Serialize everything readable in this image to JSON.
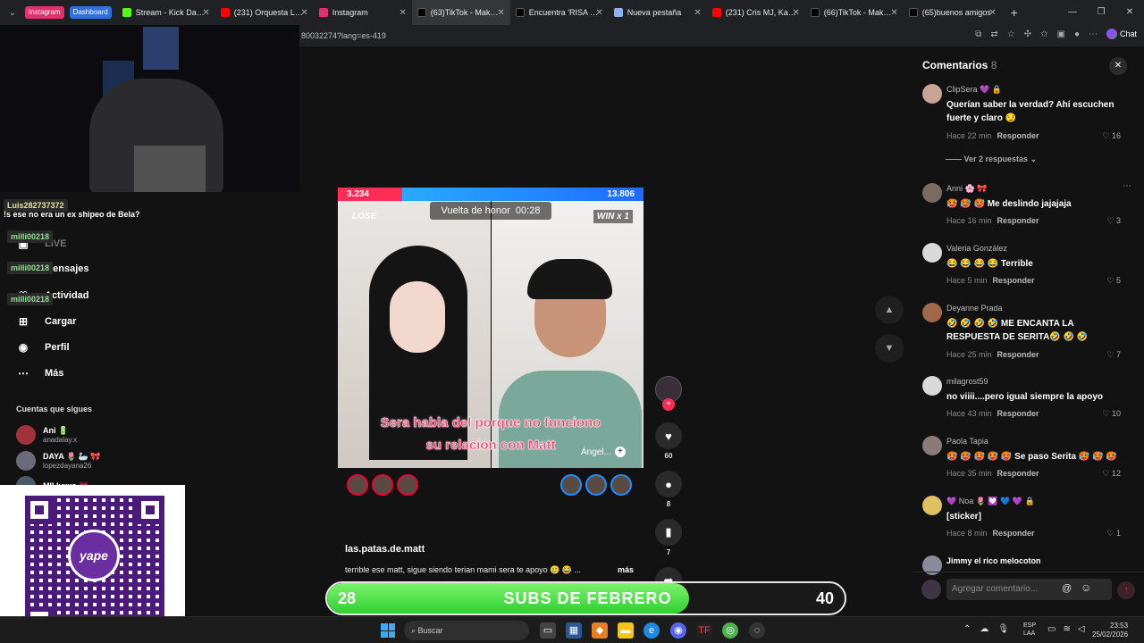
{
  "browser": {
    "pills": [
      {
        "label": "Instagram",
        "color": "#e1306c"
      },
      {
        "label": "Dashboard",
        "color": "#2f6fde"
      }
    ],
    "tabs": [
      {
        "label": "Stream - Kick Dashb",
        "color": "#53fc18"
      },
      {
        "label": "(231) Orquesta La Be",
        "color": "#ff0000"
      },
      {
        "label": "Instagram",
        "color": "#e1306c"
      },
      {
        "label": "(63)TikTok - Make Yo",
        "color": "#000000"
      },
      {
        "label": "Encuentra 'RISA DE 2",
        "color": "#000000"
      },
      {
        "label": "Nueva pestaña",
        "color": "#8ab4f8"
      },
      {
        "label": "(231) Cris MJ, Kali Uc",
        "color": "#ff0000"
      },
      {
        "label": "(66)TikTok - Make Yo",
        "color": "#000000"
      },
      {
        "label": "(65)buenos amigos",
        "color": "#000000"
      }
    ],
    "active_tab": 3,
    "url": "80032274?lang=es-419",
    "chat_label": "Chat"
  },
  "stream_chat": {
    "items": [
      {
        "user": "Luis282737372",
        "message": "!s ese no era un ex shipeo de Bela?"
      },
      {
        "user": "milli00218",
        "message": ""
      },
      {
        "user": "milli00218",
        "message": ""
      },
      {
        "user": "milli00218",
        "message": ""
      }
    ]
  },
  "sidebar": {
    "items": [
      {
        "label": "LIVE",
        "icon": "live-icon"
      },
      {
        "label": "Mensajes",
        "icon": "message-icon"
      },
      {
        "label": "Actividad",
        "icon": "activity-icon"
      },
      {
        "label": "Cargar",
        "icon": "upload-icon"
      },
      {
        "label": "Perfil",
        "icon": "profile-icon"
      },
      {
        "label": "Más",
        "icon": "more-icon"
      }
    ],
    "following_title": "Cuentas que sigues",
    "following": [
      {
        "name": "Ani 🔋",
        "handle": "anadalay.x",
        "color": "#a2323a"
      },
      {
        "name": "DAYA 🌷 🦢 🎀",
        "handle": "lopezdayana26",
        "color": "#6a6a7a"
      },
      {
        "name": "MII lyxxs 💗",
        "handle": "",
        "color": "#4a5a6a"
      }
    ]
  },
  "qr": {
    "brand": "yape"
  },
  "video": {
    "score_left": "3.234",
    "score_right": "13.806",
    "lose_label": "LOSE",
    "honor_label": "Vuelta de honor",
    "honor_time": "00:28",
    "win_label": "WIN x 1",
    "caption_line1": "Sera habla del porque no funciono",
    "caption_line2": "su relacion con Matt",
    "host_label": "Ángel...",
    "username": "las.patas.de.matt",
    "description": "terrible ese matt, sigue siendo terian mami sera te apoyo 🥲 😂 ...",
    "more_label": "más"
  },
  "actions": {
    "likes": "60",
    "comments": "8",
    "saves": "7"
  },
  "subs_goal": {
    "current": "28",
    "goal": "40",
    "title": "SUBS DE FEBRERO",
    "progress": 0.7
  },
  "comments_panel": {
    "title": "Comentarios",
    "count": "8",
    "view_replies": "Ver 2 respuestas",
    "reply_label": "Responder",
    "input_placeholder": "Agregar comentario...",
    "items": [
      {
        "user": "ClipSera 💜 🔒",
        "text": "Querían saber la verdad? Ahí escuchen fuerte y claro 😏",
        "time": "Hace 22 min",
        "likes": "16",
        "color": "#c7a496"
      },
      {
        "user": "Anni 🌸 🎀",
        "text": "🥵 🥵 🥵 Me deslindo jajajaja",
        "time": "Hace 16 min",
        "likes": "3",
        "color": "#7a6a60"
      },
      {
        "user": "Valeria González",
        "text": "😂 😂 😂 😂 Terrible",
        "time": "Hace 5 min",
        "likes": "5",
        "color": "#d9d9d9"
      },
      {
        "user": "Deyanne Prada",
        "text": "🤣 🤣 🤣 🤣 ME ENCANTA LA RESPUESTA DE SERITA🤣 🤣 🤣",
        "time": "Hace 25 min",
        "likes": "7",
        "color": "#a0674a"
      },
      {
        "user": "milagrost59",
        "text": "no viiii....pero igual siempre la apoyo",
        "time": "Hace 43 min",
        "likes": "10",
        "color": "#d9d9d9"
      },
      {
        "user": "Paola Tapia",
        "text": "🥵 🥵 🥵 🥵 🥵 Se paso Serita 🥵 🥵 🥵",
        "time": "Hace 35 min",
        "likes": "12",
        "color": "#8a7a7a"
      },
      {
        "user": "💜 Noa 🌷 💟 💙 💜 🔒",
        "text": "[sticker]",
        "time": "Hace 8 min",
        "likes": "1",
        "color": "#e0c060"
      },
      {
        "user": "Jimmy el rico melocoton",
        "text": "",
        "time": "",
        "likes": "",
        "color": "#8a8a9a"
      }
    ]
  },
  "taskbar": {
    "search_placeholder": "Buscar",
    "lang_line1": "ESP",
    "lang_line2": "LAA",
    "time": "23:53",
    "date": "25/02/2026"
  }
}
